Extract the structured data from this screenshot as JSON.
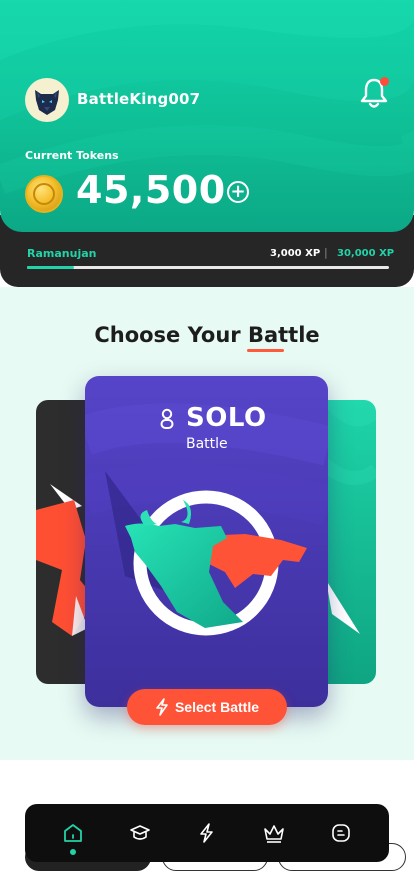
{
  "header": {
    "username": "BattleKing007",
    "tokens_label": "Current Tokens",
    "tokens_value": "45,500",
    "add_symbol": "+"
  },
  "xp": {
    "level_name": "Ramanujan",
    "current": "3,000 XP",
    "separator": "|",
    "target": "30,000 XP",
    "progress_fraction": 0.13
  },
  "battle": {
    "title_prefix": "Choose Your ",
    "title_highlight": "Battle",
    "card_title": "SOLO",
    "card_subtitle": "Battle",
    "select_label": "Select Battle"
  },
  "nav": {
    "items": [
      "home-icon",
      "learn-icon",
      "battle-icon",
      "crown-icon",
      "chat-icon"
    ],
    "active": 0
  },
  "colors": {
    "brand_green": "#12d3a8",
    "accent_red": "#ff5338",
    "card_purple": "#5745c9"
  }
}
